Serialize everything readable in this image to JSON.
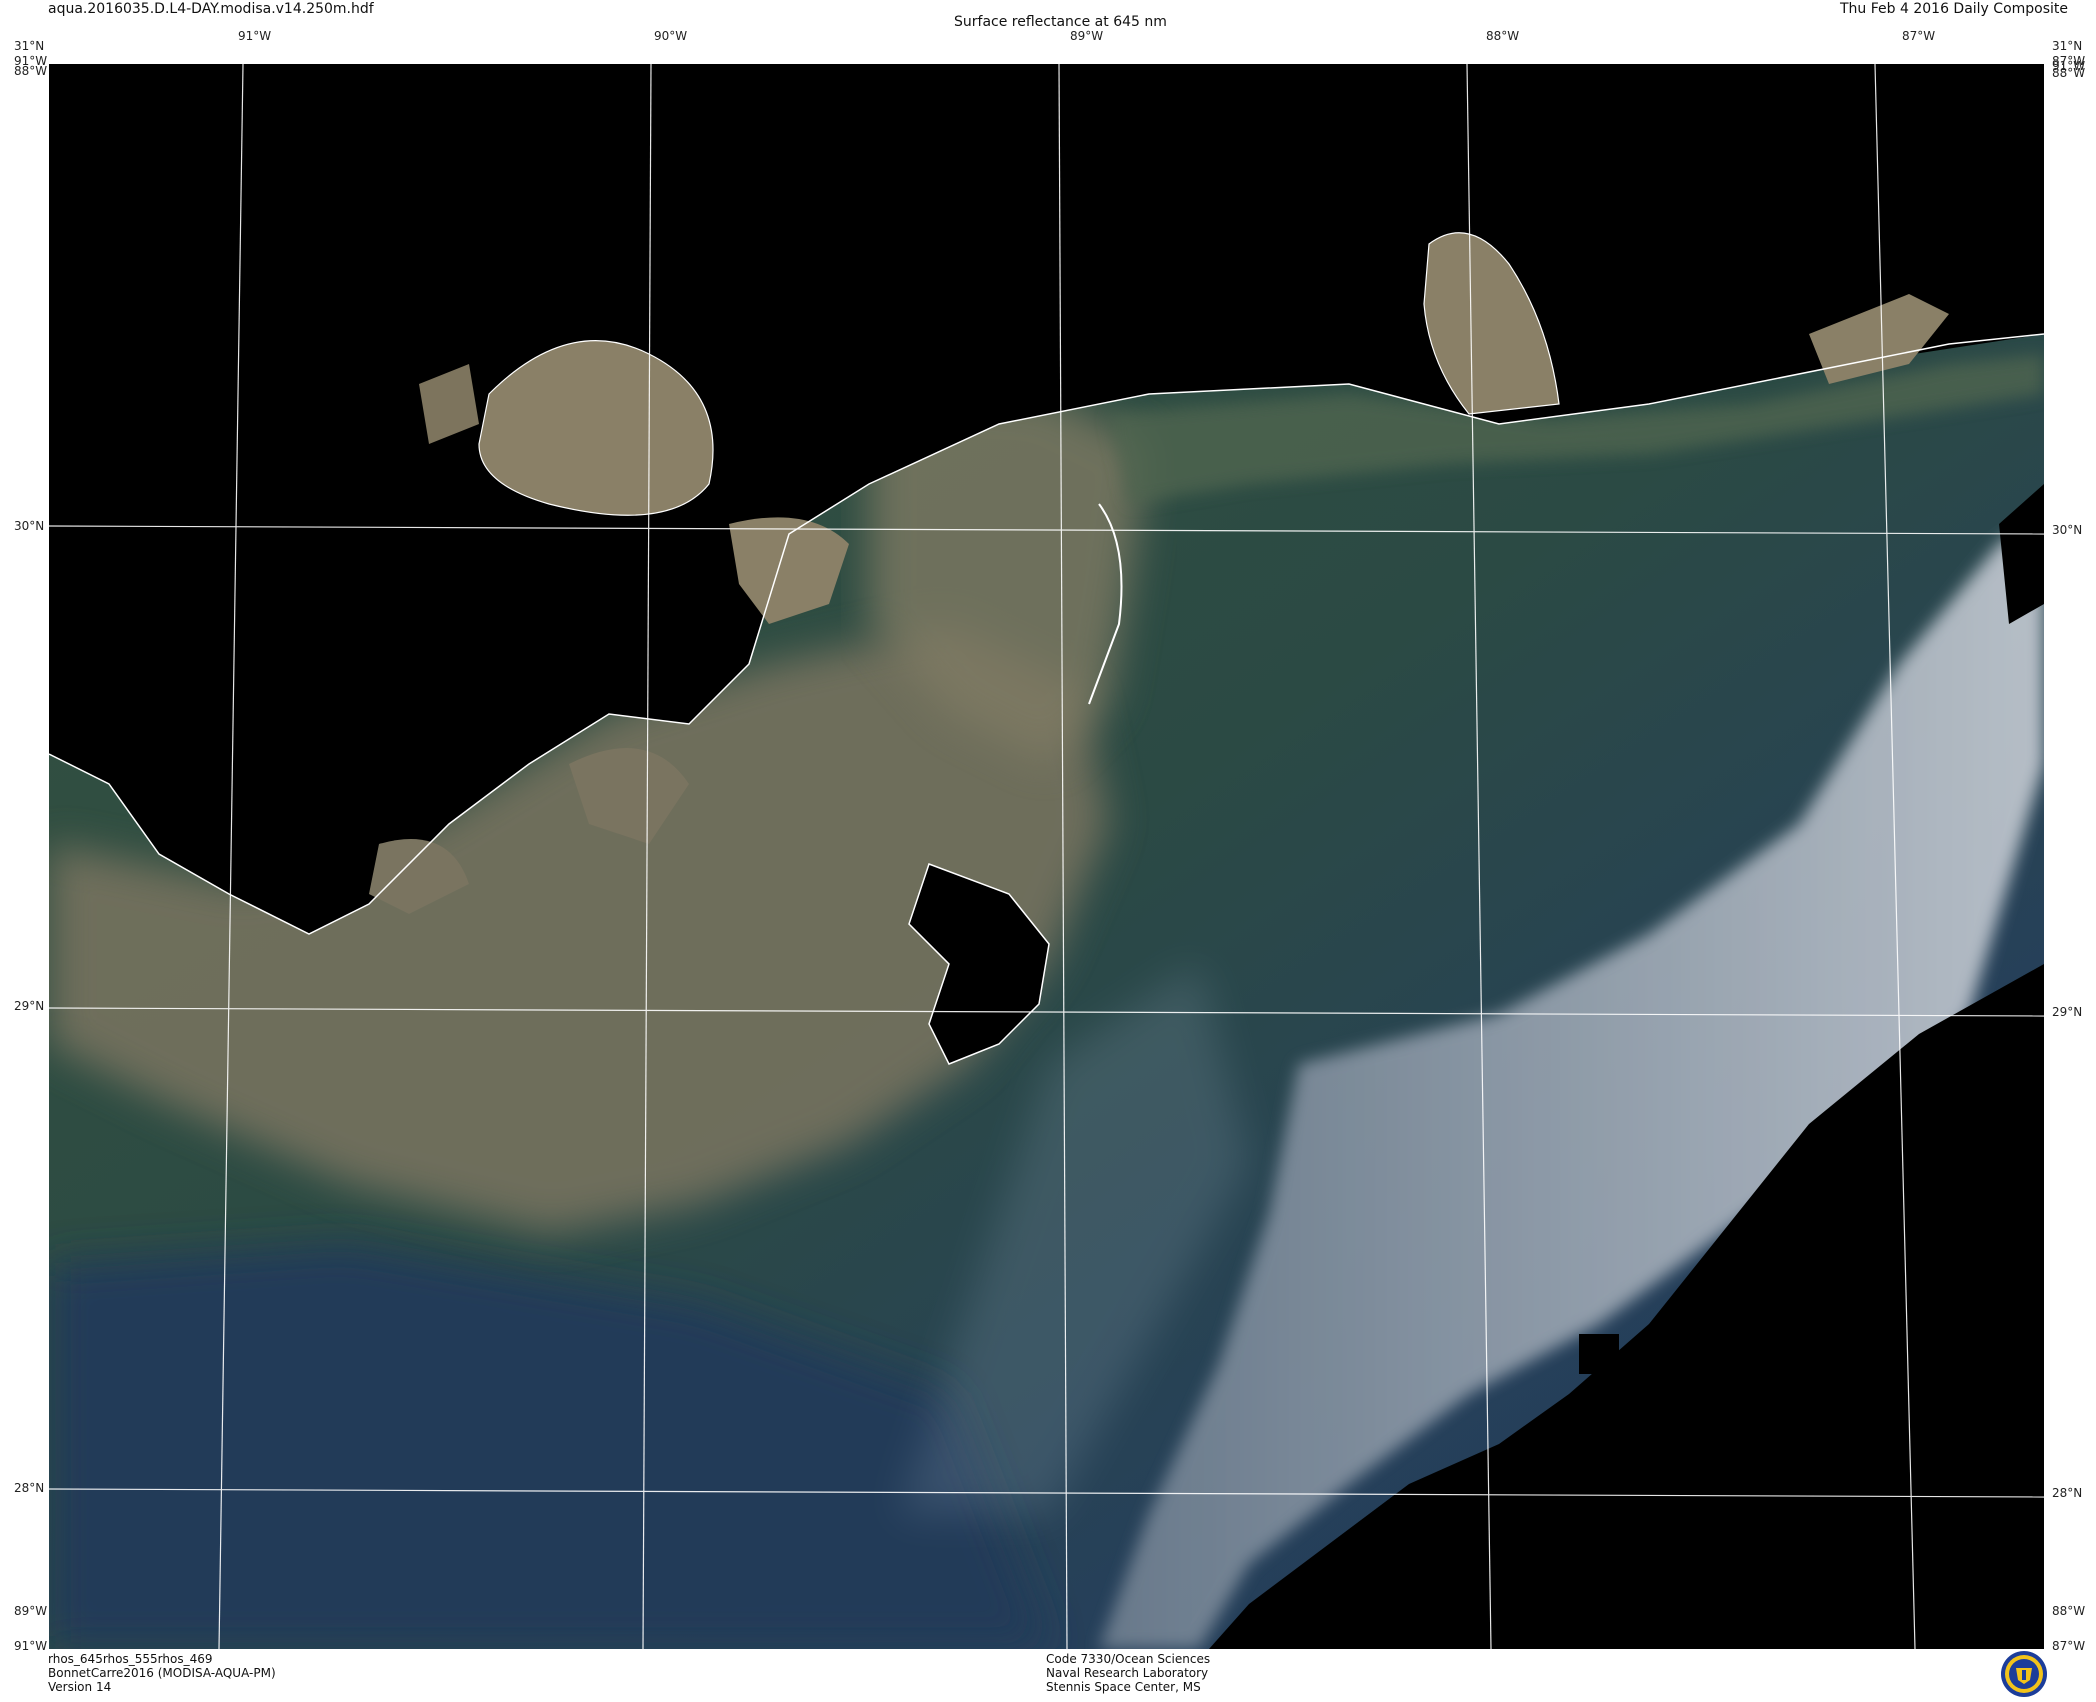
{
  "header": {
    "filename": "aqua.2016035.D.L4-DAY.modisa.v14.250m.hdf",
    "title": "Surface reflectance at 645 nm",
    "date": "Thu Feb  4 2016 Daily Composite"
  },
  "axes": {
    "top_longitudes": [
      "91°W",
      "90°W",
      "89°W",
      "88°W",
      "87°W"
    ],
    "left_latitudes": [
      "30°N",
      "29°N",
      "28°N"
    ],
    "right_latitudes": [
      "30°N",
      "29°N",
      "28°N"
    ],
    "corner_top_left": [
      "31°N",
      "91°W",
      "88°W"
    ],
    "corner_top_right": [
      "31°N",
      "87°W",
      "91°W",
      "88°W"
    ],
    "corner_bottom_left": [
      "89°W",
      "91°W"
    ],
    "corner_bottom_right": [
      "88°W",
      "87°W"
    ]
  },
  "footer": {
    "left": [
      "rhos_645rhos_555rhos_469",
      "BonnetCarre2016 (MODISA-AQUA-PM)",
      "Version 14"
    ],
    "center": [
      "Code 7330/Ocean Sciences",
      "Naval Research Laboratory",
      "Stennis Space Center, MS"
    ]
  },
  "colors": {
    "land_nodata": "#000000",
    "turbid_water": "#8a7f66",
    "shelf_water": "#2f4a3c",
    "deep_water": "#24405a",
    "cloud": "#b9c2cc",
    "coastline": "#ffffff",
    "grid": "#ffffff"
  },
  "logo": {
    "icon": "nrl-seal-icon"
  }
}
